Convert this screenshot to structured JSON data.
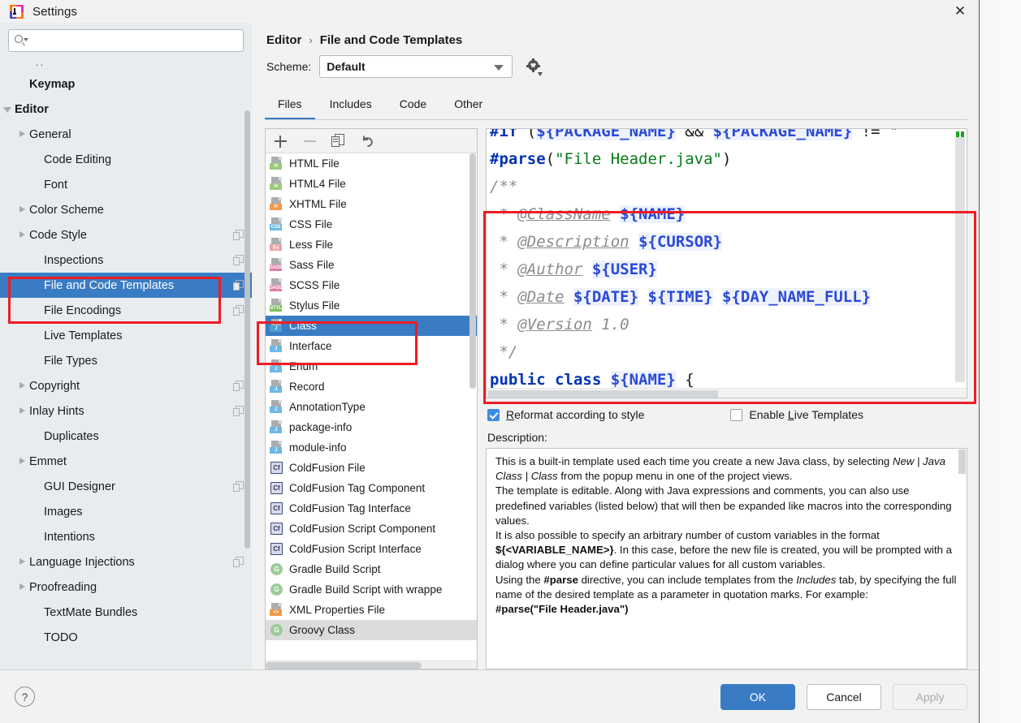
{
  "window": {
    "title": "Settings",
    "close_label": "✕",
    "app_icon": "intellij-idea-icon"
  },
  "sidebar": {
    "search": {
      "value": "",
      "placeholder": "",
      "icon": "search-icon"
    },
    "ellipsis": "..",
    "items": [
      {
        "label": "Keymap",
        "bold": true,
        "twisty": "none",
        "indent": 36,
        "copy": false
      },
      {
        "label": "Editor",
        "bold": true,
        "twisty": "down",
        "indent": 18,
        "copy": false
      },
      {
        "label": "General",
        "bold": false,
        "twisty": "right",
        "indent": 36,
        "copy": false
      },
      {
        "label": "Code Editing",
        "bold": false,
        "twisty": "none",
        "indent": 54,
        "copy": false
      },
      {
        "label": "Font",
        "bold": false,
        "twisty": "none",
        "indent": 54,
        "copy": false
      },
      {
        "label": "Color Scheme",
        "bold": false,
        "twisty": "right",
        "indent": 36,
        "copy": false
      },
      {
        "label": "Code Style",
        "bold": false,
        "twisty": "right",
        "indent": 36,
        "copy": true
      },
      {
        "label": "Inspections",
        "bold": false,
        "twisty": "none",
        "indent": 54,
        "copy": true
      },
      {
        "label": "File and Code Templates",
        "bold": false,
        "twisty": "none",
        "indent": 54,
        "copy": true,
        "selected": true
      },
      {
        "label": "File Encodings",
        "bold": false,
        "twisty": "none",
        "indent": 54,
        "copy": true
      },
      {
        "label": "Live Templates",
        "bold": false,
        "twisty": "none",
        "indent": 54,
        "copy": false
      },
      {
        "label": "File Types",
        "bold": false,
        "twisty": "none",
        "indent": 54,
        "copy": false
      },
      {
        "label": "Copyright",
        "bold": false,
        "twisty": "right",
        "indent": 36,
        "copy": true
      },
      {
        "label": "Inlay Hints",
        "bold": false,
        "twisty": "right",
        "indent": 36,
        "copy": true
      },
      {
        "label": "Duplicates",
        "bold": false,
        "twisty": "none",
        "indent": 54,
        "copy": false
      },
      {
        "label": "Emmet",
        "bold": false,
        "twisty": "right",
        "indent": 36,
        "copy": false
      },
      {
        "label": "GUI Designer",
        "bold": false,
        "twisty": "none",
        "indent": 54,
        "copy": true
      },
      {
        "label": "Images",
        "bold": false,
        "twisty": "none",
        "indent": 54,
        "copy": false
      },
      {
        "label": "Intentions",
        "bold": false,
        "twisty": "none",
        "indent": 54,
        "copy": false
      },
      {
        "label": "Language Injections",
        "bold": false,
        "twisty": "right",
        "indent": 36,
        "copy": true
      },
      {
        "label": "Proofreading",
        "bold": false,
        "twisty": "right",
        "indent": 36,
        "copy": false
      },
      {
        "label": "TextMate Bundles",
        "bold": false,
        "twisty": "none",
        "indent": 54,
        "copy": false
      },
      {
        "label": "TODO",
        "bold": false,
        "twisty": "none",
        "indent": 54,
        "copy": false
      }
    ]
  },
  "breadcrumb": {
    "parent": "Editor",
    "separator": "›",
    "current": "File and Code Templates"
  },
  "scheme": {
    "label": "Scheme:",
    "value": "Default",
    "gear_icon": "gear-icon"
  },
  "tabs": [
    {
      "label": "Files",
      "active": true
    },
    {
      "label": "Includes",
      "active": false
    },
    {
      "label": "Code",
      "active": false
    },
    {
      "label": "Other",
      "active": false
    }
  ],
  "template_toolbar": {
    "add": "+",
    "remove": "−",
    "copy": "copy-icon",
    "reset": "undo-icon"
  },
  "template_list": [
    {
      "name": "HTML File",
      "icon": "file",
      "badge": "H",
      "badge_color": "#9cc97b"
    },
    {
      "name": "HTML4 File",
      "icon": "file",
      "badge": "H",
      "badge_color": "#9cc97b"
    },
    {
      "name": "XHTML File",
      "icon": "file",
      "badge": "H",
      "badge_color": "#f2994a"
    },
    {
      "name": "CSS File",
      "icon": "file",
      "badge": "CSS",
      "badge_color": "#6cb8e6"
    },
    {
      "name": "Less File",
      "icon": "file",
      "badge": "{L}",
      "badge_color": "#e8a2a2"
    },
    {
      "name": "Sass File",
      "icon": "file",
      "badge": "SASS",
      "badge_color": "#e27ba5"
    },
    {
      "name": "SCSS File",
      "icon": "file",
      "badge": "SASS",
      "badge_color": "#e27ba5"
    },
    {
      "name": "Stylus File",
      "icon": "file",
      "badge": "STYL",
      "badge_color": "#7fbf5a"
    },
    {
      "name": "Class",
      "icon": "file",
      "badge": "J",
      "badge_color": "#4a9fd6",
      "selected": true
    },
    {
      "name": "Interface",
      "icon": "file",
      "badge": "J",
      "badge_color": "#6cb8e6"
    },
    {
      "name": "Enum",
      "icon": "file",
      "badge": "J",
      "badge_color": "#6cb8e6"
    },
    {
      "name": "Record",
      "icon": "file",
      "badge": "J",
      "badge_color": "#6cb8e6"
    },
    {
      "name": "AnnotationType",
      "icon": "file",
      "badge": "J",
      "badge_color": "#6cb8e6"
    },
    {
      "name": "package-info",
      "icon": "file",
      "badge": "J",
      "badge_color": "#6cb8e6"
    },
    {
      "name": "module-info",
      "icon": "file",
      "badge": "J",
      "badge_color": "#6cb8e6"
    },
    {
      "name": "ColdFusion File",
      "icon": "square",
      "badge": "Cf"
    },
    {
      "name": "ColdFusion Tag Component",
      "icon": "square",
      "badge": "Cf"
    },
    {
      "name": "ColdFusion Tag Interface",
      "icon": "square",
      "badge": "Cf"
    },
    {
      "name": "ColdFusion Script Component",
      "icon": "square",
      "badge": "Cf"
    },
    {
      "name": "ColdFusion Script Interface",
      "icon": "square",
      "badge": "Cf"
    },
    {
      "name": "Gradle Build Script",
      "icon": "circle",
      "badge": "G"
    },
    {
      "name": "Gradle Build Script with wrappe",
      "icon": "circle",
      "badge": "G"
    },
    {
      "name": "XML Properties File",
      "icon": "file",
      "badge": "<>",
      "badge_color": "#f2994a"
    },
    {
      "name": "Groovy Class",
      "icon": "circle",
      "badge": "G",
      "highlighted": true
    }
  ],
  "code": {
    "lines": [
      [
        {
          "t": "#if ",
          "c": "kw"
        },
        {
          "t": "(",
          "c": "plain"
        },
        {
          "t": "${PACKAGE_NAME}",
          "c": "var"
        },
        {
          "t": " && ",
          "c": "plain"
        },
        {
          "t": "${PACKAGE_NAME}",
          "c": "var"
        },
        {
          "t": " != \"",
          "c": "plain"
        }
      ],
      [
        {
          "t": "#parse",
          "c": "kw"
        },
        {
          "t": "(",
          "c": "plain"
        },
        {
          "t": "\"File Header.java\"",
          "c": "str"
        },
        {
          "t": ")",
          "c": "plain"
        }
      ],
      [
        {
          "t": "/**",
          "c": "cmt"
        }
      ],
      [
        {
          "t": " * ",
          "c": "cmt"
        },
        {
          "t": "@ClassName",
          "c": "cmt-u"
        },
        {
          "t": " ",
          "c": "cmt"
        },
        {
          "t": "${NAME}",
          "c": "var"
        }
      ],
      [
        {
          "t": " * ",
          "c": "cmt"
        },
        {
          "t": "@Description",
          "c": "cmt-u"
        },
        {
          "t": " ",
          "c": "cmt"
        },
        {
          "t": "${CURSOR}",
          "c": "var"
        }
      ],
      [
        {
          "t": " * ",
          "c": "cmt"
        },
        {
          "t": "@Author",
          "c": "cmt-u"
        },
        {
          "t": " ",
          "c": "cmt"
        },
        {
          "t": "${USER}",
          "c": "var"
        }
      ],
      [
        {
          "t": " * ",
          "c": "cmt"
        },
        {
          "t": "@Date",
          "c": "cmt-u"
        },
        {
          "t": " ",
          "c": "cmt"
        },
        {
          "t": "${DATE}",
          "c": "var"
        },
        {
          "t": " ",
          "c": "cmt"
        },
        {
          "t": "${TIME}",
          "c": "var"
        },
        {
          "t": " ",
          "c": "cmt"
        },
        {
          "t": "${DAY_NAME_FULL}",
          "c": "var"
        }
      ],
      [
        {
          "t": " * ",
          "c": "cmt"
        },
        {
          "t": "@Version",
          "c": "cmt-u"
        },
        {
          "t": " 1.0",
          "c": "cmt"
        }
      ],
      [
        {
          "t": " */",
          "c": "cmt"
        }
      ],
      [
        {
          "t": "public class ",
          "c": "kw"
        },
        {
          "t": "${NAME}",
          "c": "var"
        },
        {
          "t": " {",
          "c": "plain"
        }
      ]
    ]
  },
  "options": {
    "reformat": {
      "label_pre": "R",
      "label_rest": "eformat according to style",
      "checked": true
    },
    "live_templates": {
      "label_pre": "Enable ",
      "label_u": "L",
      "label_rest": "ive Templates",
      "checked": false
    }
  },
  "description": {
    "label": "Description:",
    "paragraphs": [
      {
        "parts": [
          {
            "t": "This is a built-in template used each time you create a new Java class, by selecting ",
            "s": "n"
          },
          {
            "t": "New | Java Class | Class",
            "s": "i"
          },
          {
            "t": " from the popup menu in one of the project views.",
            "s": "n"
          }
        ]
      },
      {
        "parts": [
          {
            "t": "The template is editable. Along with Java expressions and comments, you can also use predefined variables (listed below) that will then be expanded like macros into the corresponding values.",
            "s": "n"
          }
        ]
      },
      {
        "parts": [
          {
            "t": "It is also possible to specify an arbitrary number of custom variables in the format ",
            "s": "n"
          },
          {
            "t": "${<VARIABLE_NAME>}",
            "s": "b"
          },
          {
            "t": ". In this case, before the new file is created, you will be prompted with a dialog where you can define particular values for all custom variables.",
            "s": "n"
          }
        ]
      },
      {
        "parts": [
          {
            "t": "Using the ",
            "s": "n"
          },
          {
            "t": "#parse",
            "s": "b"
          },
          {
            "t": " directive, you can include templates from the ",
            "s": "n"
          },
          {
            "t": "Includes",
            "s": "i"
          },
          {
            "t": " tab, by specifying the full name of the desired template as a parameter in quotation marks. For example:",
            "s": "n"
          }
        ]
      },
      {
        "parts": [
          {
            "t": "#parse(\"File Header.java\")",
            "s": "b"
          }
        ]
      }
    ]
  },
  "footer": {
    "help": "?",
    "ok": "OK",
    "cancel": "Cancel",
    "apply": "Apply"
  },
  "annotations": {
    "color": "#ee1c25",
    "boxes": [
      "sidebar-file-and-code-templates",
      "template-list-class",
      "code-javadoc-block"
    ]
  }
}
